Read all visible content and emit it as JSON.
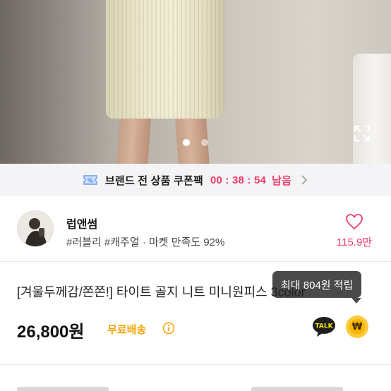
{
  "hero": {
    "image_alt": "",
    "slides_total": 2,
    "active_slide": 1,
    "expand_icon": "expand-icon"
  },
  "coupon": {
    "icon": "coupon-ticket-icon",
    "title": "브랜드 전 상품 쿠폰팩",
    "timer": "00 : 38 : 54",
    "suffix": "남음",
    "accent_color": "#ee3a6a"
  },
  "seller": {
    "name": "럽앤썸",
    "tags": "#러블리 #캐주얼",
    "meta_separator": "·",
    "satisfaction": "마켓 만족도 92%",
    "like_count": "115.9만"
  },
  "product": {
    "title": "[겨울두께감/쫀쫀!] 타이트 골지 니트 미니원피스 3color",
    "price": "26,800원",
    "shipping": "무료배송",
    "shipping_color": "#f5a300",
    "talk_label": "TALK",
    "point_symbol": "₩",
    "tooltip": "최대 804원 적립"
  }
}
